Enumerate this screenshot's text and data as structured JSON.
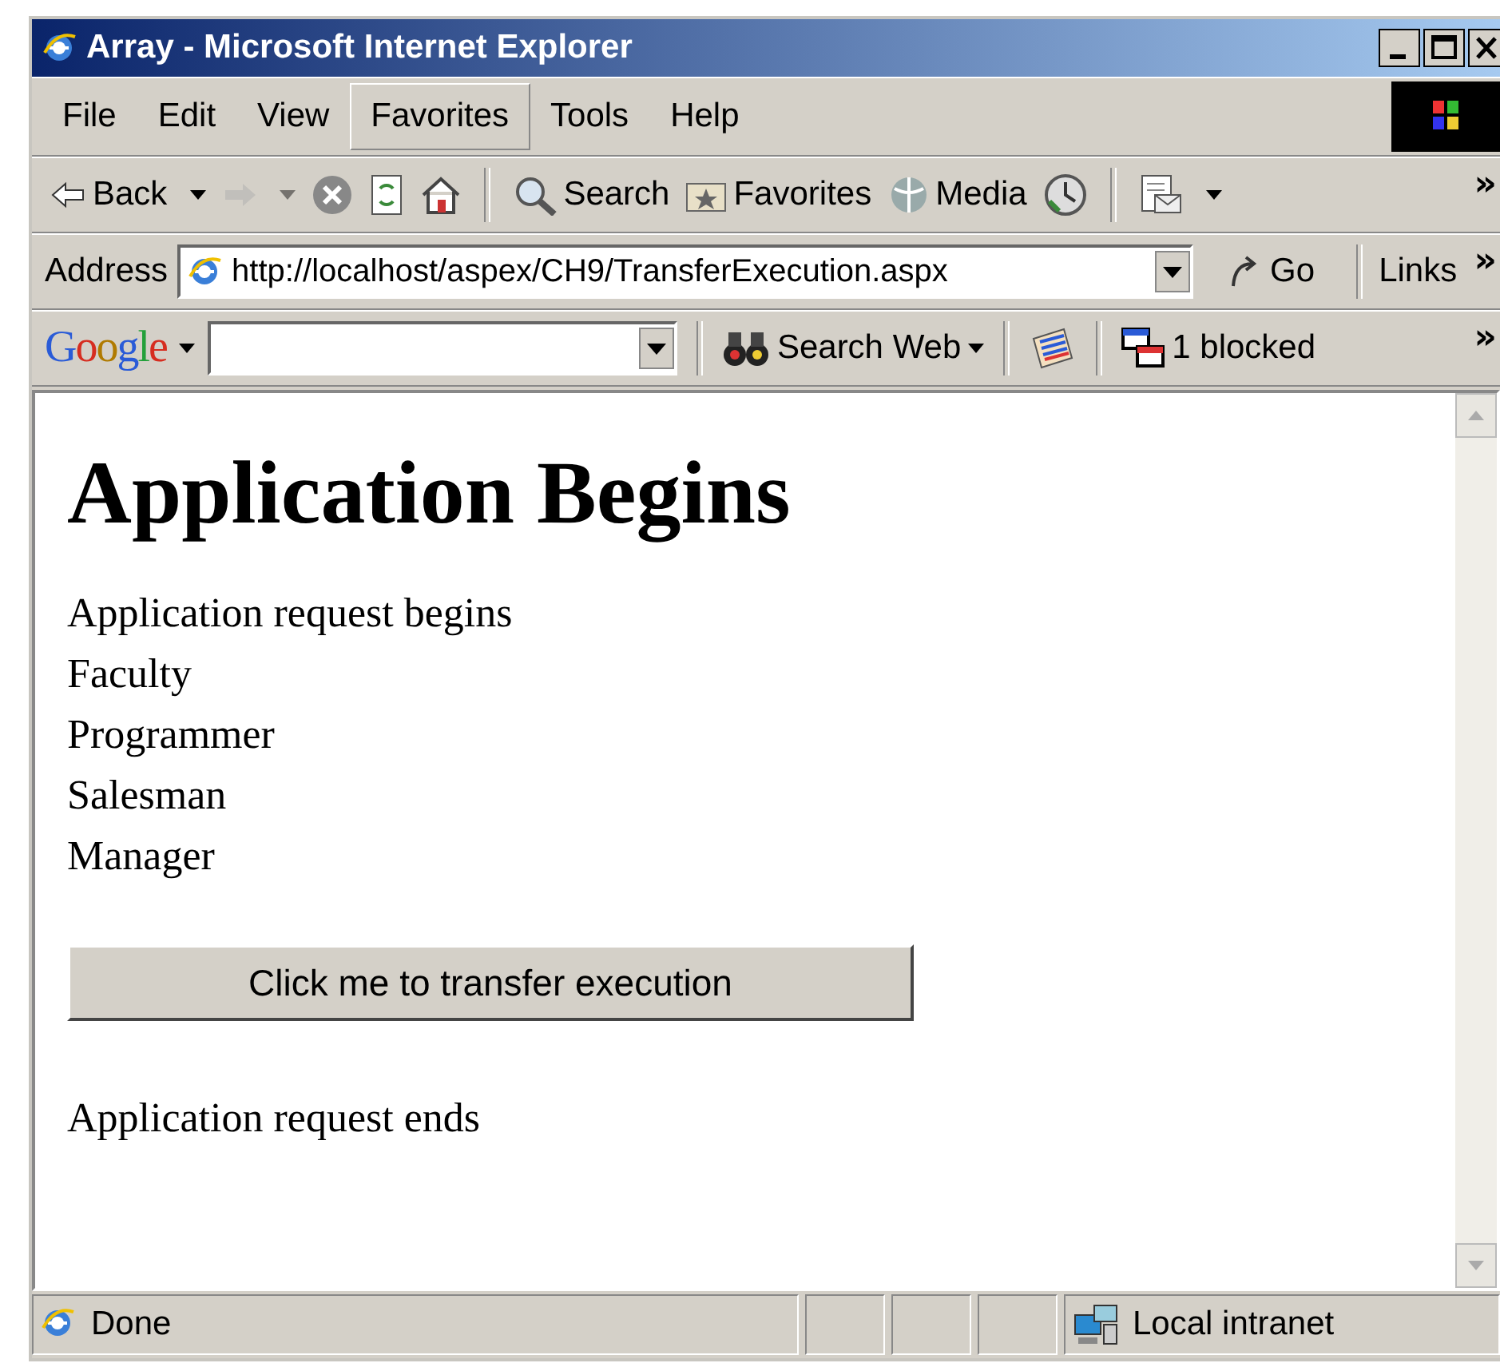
{
  "window": {
    "title": "Array - Microsoft Internet Explorer"
  },
  "menu": [
    {
      "label": "File",
      "highlighted": false
    },
    {
      "label": "Edit",
      "highlighted": false
    },
    {
      "label": "View",
      "highlighted": false
    },
    {
      "label": "Favorites",
      "highlighted": true
    },
    {
      "label": "Tools",
      "highlighted": false
    },
    {
      "label": "Help",
      "highlighted": false
    }
  ],
  "toolbar": [
    {
      "kind": "button",
      "label": "Back",
      "dropdown": true,
      "disabled": false
    },
    {
      "kind": "button",
      "dropdown": true,
      "disabled": true
    },
    {
      "kind": "button",
      "dropdown": false,
      "disabled": false
    },
    {
      "kind": "button",
      "dropdown": false,
      "disabled": false
    },
    {
      "kind": "button",
      "dropdown": false,
      "disabled": false
    },
    {
      "kind": "separator"
    },
    {
      "kind": "button",
      "label": "Search",
      "dropdown": false,
      "disabled": false
    },
    {
      "kind": "button",
      "label": "Favorites",
      "dropdown": false,
      "disabled": false
    },
    {
      "kind": "button",
      "label": "Media",
      "dropdown": false,
      "disabled": false
    },
    {
      "kind": "button",
      "dropdown": false,
      "disabled": false
    },
    {
      "kind": "separator"
    },
    {
      "kind": "button",
      "dropdown": true,
      "disabled": false
    },
    {
      "kind": "chevron",
      "label": "»"
    }
  ],
  "address_bar": {
    "label": "Address",
    "url": "http://localhost/aspex/CH9/TransferExecution.aspx",
    "go": "Go",
    "links": "Links",
    "more": "»"
  },
  "google_bar": {
    "logo": "Google",
    "search_button": "Search Web",
    "popups": "1 blocked",
    "more": "»"
  },
  "page": {
    "heading": "Application Begins",
    "lines": [
      "Application request begins",
      "Faculty",
      "Programmer",
      "Salesman",
      "Manager"
    ],
    "button": "Click me to transfer execution",
    "footer": "Application request ends"
  },
  "status_bar": {
    "text": "Done",
    "zone": "Local intranet"
  }
}
